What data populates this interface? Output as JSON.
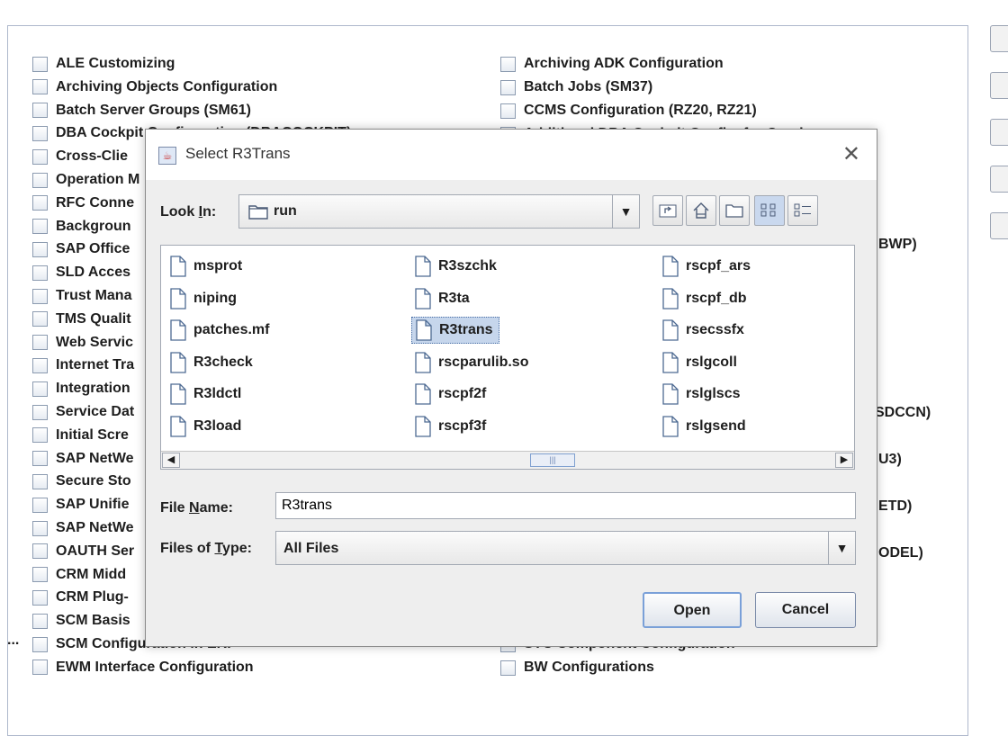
{
  "background": {
    "left_column": [
      "ALE Customizing",
      "Archiving Objects Configuration",
      "Batch Server Groups (SM61)",
      "DBA Cockpit Configuration (DBACOCKPIT)",
      "Cross-Clie",
      "Operation M",
      "RFC Conne",
      "Backgroun",
      "SAP Office",
      "SLD Acces",
      "Trust Mana",
      "TMS Qualit",
      "Web Servic",
      "Internet Tra",
      "Integration",
      "Service Dat",
      "Initial Scre",
      "SAP NetWe",
      "Secure Sto",
      "SAP Unifie",
      "SAP NetWe",
      "OAUTH Ser",
      "CRM Midd",
      "CRM Plug-",
      "SCM Basis",
      "SCM Configuration in ERP",
      "EWM Interface Configuration"
    ],
    "right_column": [
      "Archiving ADK Configuration",
      "Batch Jobs (SM37)",
      "CCMS Configuration (RZ20, RZ21)",
      "Additional DBA Cockpit Config. for Oracle",
      "STC Component Configuration",
      "BW Configurations"
    ],
    "right_fragments": [
      "BWP)",
      "SDCCN)",
      "U3)",
      "ETD)",
      "ODEL)"
    ],
    "ellipsis": "..."
  },
  "dialog": {
    "title": "Select R3Trans",
    "look_in_label_pre": "Look ",
    "look_in_label_u": "I",
    "look_in_label_post": "n:",
    "look_in_value": "run",
    "files": [
      [
        "msprot",
        "niping",
        "patches.mf",
        "R3check",
        "R3ldctl",
        "R3load"
      ],
      [
        "R3szchk",
        "R3ta",
        "R3trans",
        "rscparulib.so",
        "rscpf2f",
        "rscpf3f"
      ],
      [
        "rscpf_ars",
        "rscpf_db",
        "rsecssfx",
        "rslgcoll",
        "rslglscs",
        "rslgsend"
      ]
    ],
    "selected_file": "R3trans",
    "file_name_label_pre": "File ",
    "file_name_label_u": "N",
    "file_name_label_post": "ame:",
    "file_name_value": "R3trans",
    "files_of_type_label_pre": "Files of ",
    "files_of_type_label_u": "T",
    "files_of_type_label_post": "ype:",
    "files_of_type_value": "All Files",
    "open_label": "Open",
    "cancel_label": "Cancel"
  }
}
